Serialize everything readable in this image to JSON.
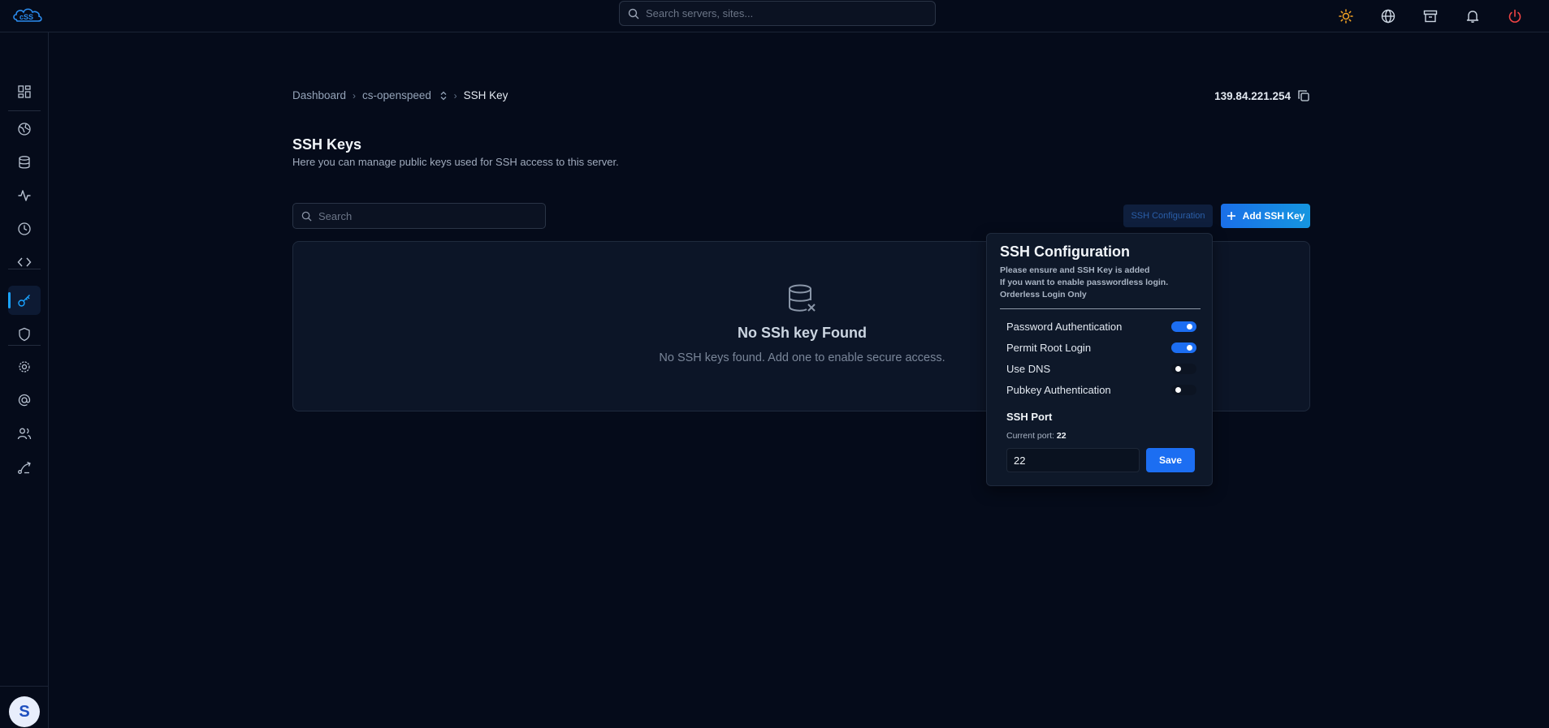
{
  "header": {
    "search_placeholder": "Search servers, sites...",
    "icons": [
      "sun-icon",
      "globe-icon",
      "archive-icon",
      "bell-icon",
      "power-icon"
    ]
  },
  "sidebar": {
    "items": [
      {
        "icon": "dashboard-grid-icon"
      },
      {
        "icon": "sites-icon"
      },
      {
        "icon": "database-icon"
      },
      {
        "icon": "activity-icon"
      },
      {
        "icon": "clock-icon"
      },
      {
        "icon": "code-icon"
      },
      {
        "icon": "key-icon",
        "active": true
      },
      {
        "icon": "shield-icon"
      },
      {
        "icon": "settings-icon"
      },
      {
        "icon": "at-sign-icon"
      },
      {
        "icon": "users-icon"
      },
      {
        "icon": "deploy-icon"
      }
    ],
    "avatar_initial": "S"
  },
  "breadcrumb": {
    "items": [
      "Dashboard",
      "cs-openspeed",
      "SSH Key"
    ]
  },
  "server_ip": "139.84.221.254",
  "page": {
    "title": "SSH Keys",
    "description": "Here you can manage public keys used for SSH access to this server.",
    "search_placeholder": "Search",
    "config_button": "SSH Configuration",
    "add_button": "Add SSH Key"
  },
  "empty_state": {
    "title": "No SSh key Found",
    "description": "No SSH keys found. Add one to enable secure access."
  },
  "ssh_config": {
    "title": "SSH Configuration",
    "notes": [
      "Please ensure and SSH Key is added",
      "If you want to enable passwordless login.",
      "Orderless Login Only"
    ],
    "toggles": [
      {
        "label": "Password Authentication",
        "enabled": true
      },
      {
        "label": "Permit Root Login",
        "enabled": true
      },
      {
        "label": "Use DNS",
        "enabled": false
      },
      {
        "label": "Pubkey Authentication",
        "enabled": false
      }
    ],
    "port_label": "SSH Port",
    "current_port_label": "Current port:",
    "current_port": "22",
    "port_value": "22",
    "save_button": "Save"
  },
  "colors": {
    "background": "#050b1a",
    "accent": "#1c6ef2",
    "active_indicator": "#1aa3ff",
    "sun": "#f5a524",
    "power": "#ef4444"
  }
}
